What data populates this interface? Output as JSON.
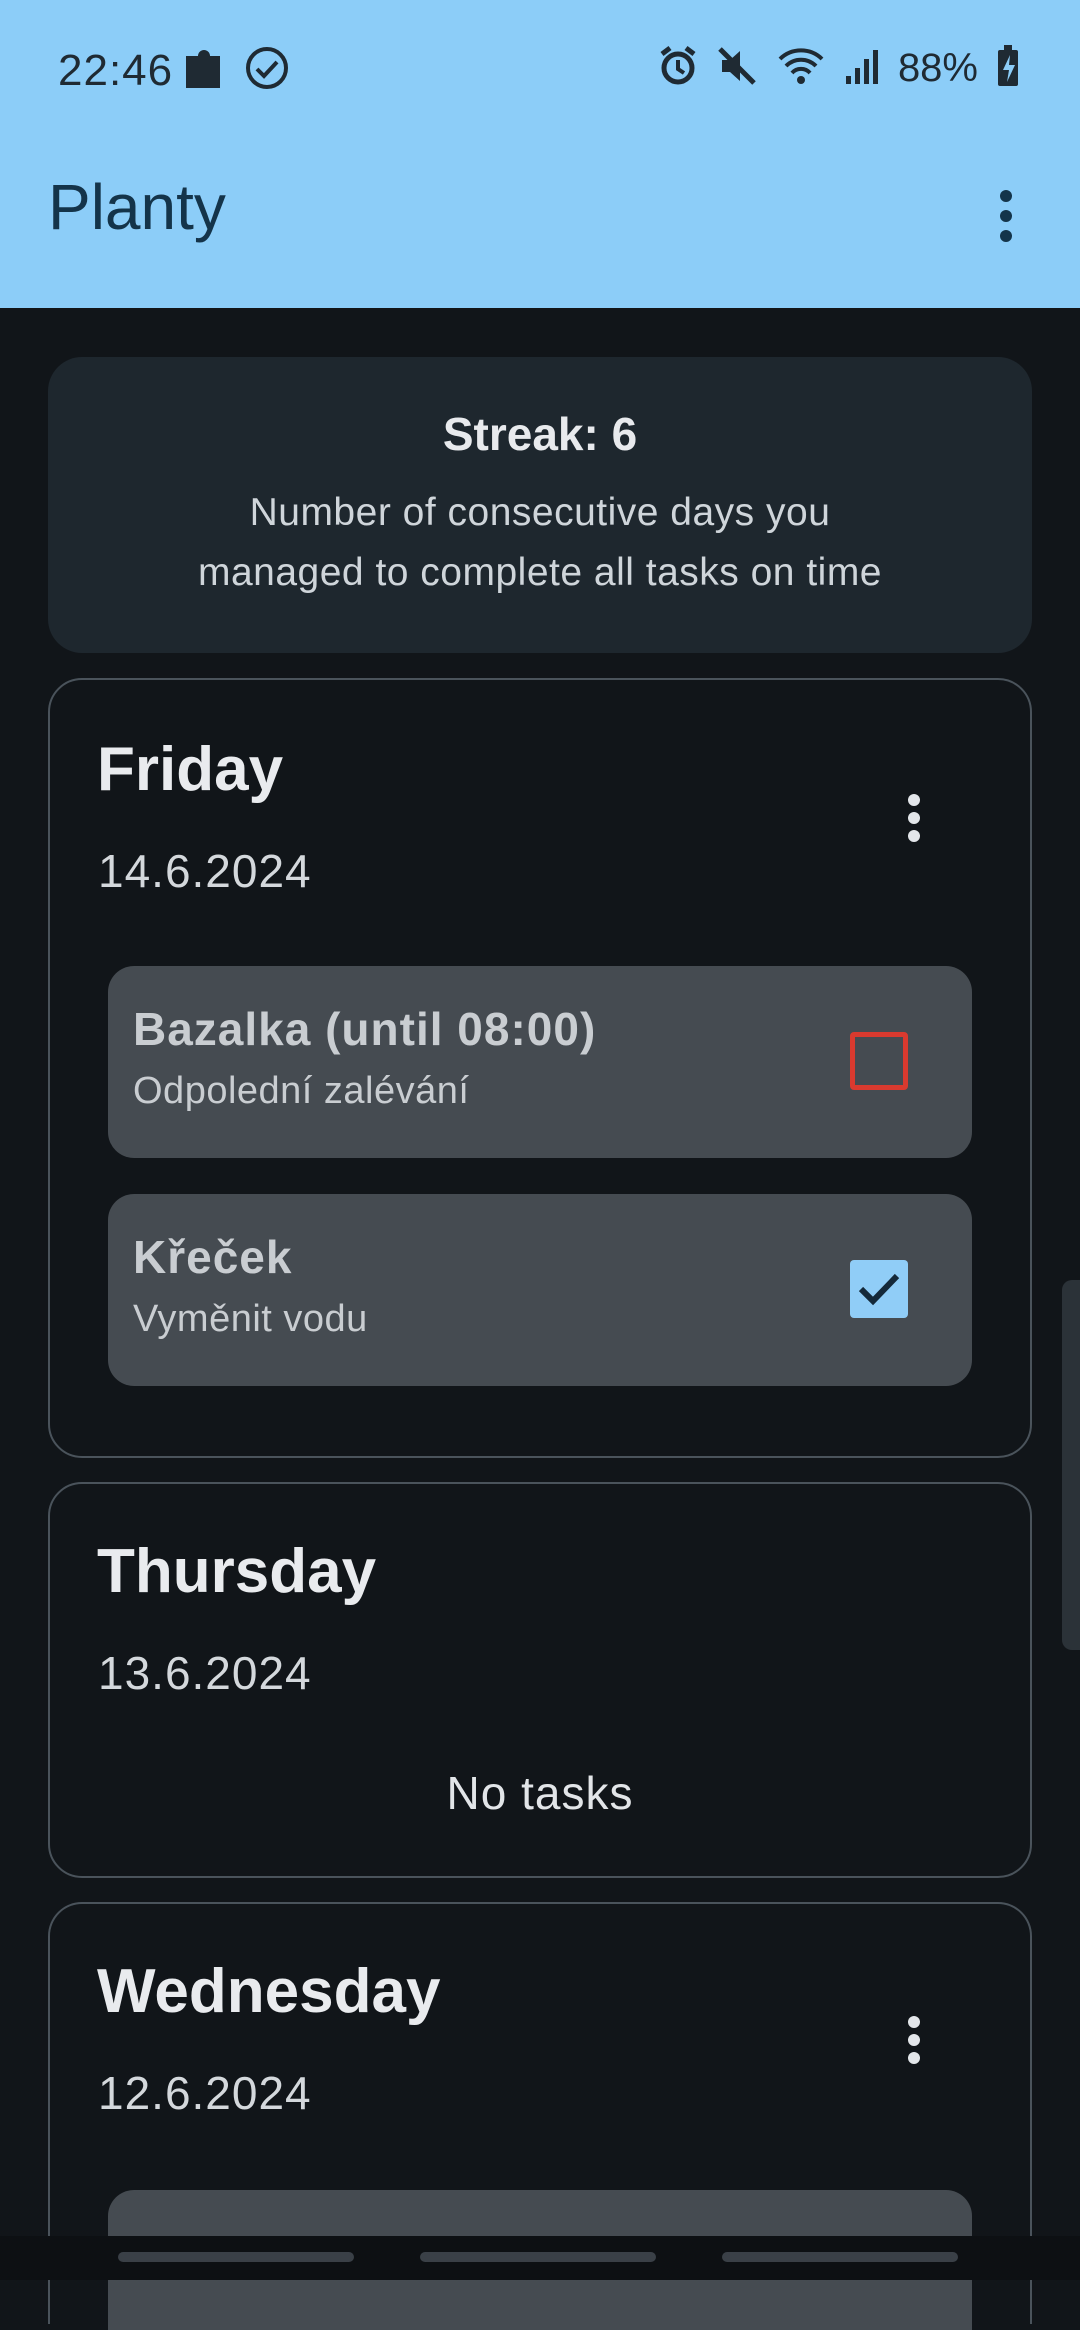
{
  "status_bar": {
    "time": "22:46",
    "battery": "88%",
    "left_icons": [
      "puzzle-icon",
      "check-circle-icon"
    ],
    "right_icons": [
      "alarm-icon",
      "mute-icon",
      "wifi-icon",
      "signal-icon",
      "battery-charging-icon"
    ]
  },
  "app_bar": {
    "title": "Planty",
    "menu_icon": "more-vert-icon"
  },
  "streak": {
    "title": "Streak: 6",
    "description_line1": "Number of consecutive days you",
    "description_line2": "managed to complete all tasks on time"
  },
  "days": [
    {
      "name": "Friday",
      "date": "14.6.2024",
      "tasks": [
        {
          "title": "Bazalka (until 08:00)",
          "subtitle": "Odpolední zalévání",
          "done": false
        },
        {
          "title": "Křeček",
          "subtitle": "Vyměnit vodu",
          "done": true
        }
      ]
    },
    {
      "name": "Thursday",
      "date": "13.6.2024",
      "empty_text": "No tasks"
    },
    {
      "name": "Wednesday",
      "date": "12.6.2024"
    }
  ],
  "colors": {
    "app_bar": "#8ccdf8",
    "background": "#111519",
    "task_card": "#454b51",
    "checkbox_unchecked": "#d93a2f",
    "checkbox_checked": "#90cdf7"
  }
}
